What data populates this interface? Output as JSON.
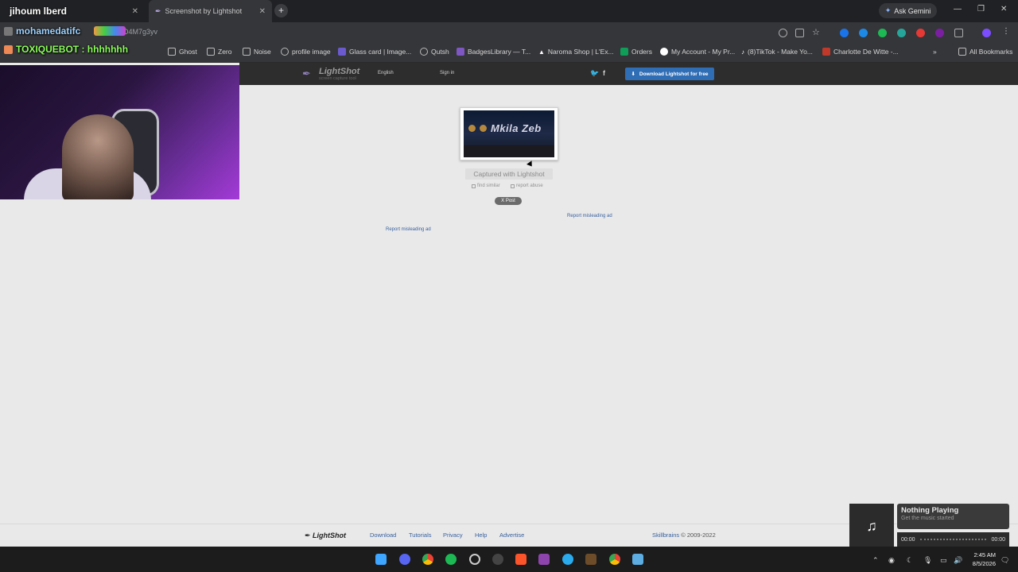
{
  "browser": {
    "tabs": [
      {
        "label": "jihoum lberd",
        "active": false
      },
      {
        "label": "Screenshot by Lightshot",
        "active": true
      }
    ],
    "new_tab": "+",
    "ask_gemini": "Ask Gemini",
    "url": "prnt.sc/3O4M7g3yv",
    "bookmarks": [
      {
        "label": "Ghost",
        "icon": "folder-icon"
      },
      {
        "label": "Zero",
        "icon": "folder-icon"
      },
      {
        "label": "Noise",
        "icon": "folder-icon"
      },
      {
        "label": "profile image",
        "icon": "globe-icon"
      },
      {
        "label": "Glass card | Image...",
        "icon": "purple-app-icon"
      },
      {
        "label": "Qutsh",
        "icon": "globe-icon"
      },
      {
        "label": "BadgesLibrary — T...",
        "icon": "badge-icon"
      },
      {
        "label": "Naroma Shop | L'Ex...",
        "icon": "triangle-icon"
      },
      {
        "label": "Orders",
        "icon": "sheet-icon"
      },
      {
        "label": "My Account - My Pr...",
        "icon": "account-icon"
      },
      {
        "label": "(8)TikTok - Make Yo...",
        "icon": "tiktok-icon"
      },
      {
        "label": "Charlotte De Witte -...",
        "icon": "image-icon"
      }
    ],
    "all_bookmarks": "All Bookmarks"
  },
  "stream_overlay": {
    "title_line": "jihoum lberd",
    "chat_user": "mohamedatifc",
    "bot_line": "TOXIQUEBOT : hhhhhhh"
  },
  "lightshot": {
    "logo": "LightShot",
    "tagline": "screen capture tool",
    "language": "English",
    "sign_in": "Sign in",
    "download_button": "Download Lightshot for free",
    "screenshot_text": "Mkila Zeb",
    "captured_with": "Captured with Lightshot",
    "find_similar": "find similar",
    "report_abuse": "report abuse",
    "x_post": "X Post",
    "report_ad_1": "Report misleading ad",
    "report_ad_2": "Report misleading ad",
    "footer": {
      "logo": "LightShot",
      "links": [
        "Download",
        "Tutorials",
        "Privacy",
        "Help",
        "Advertise"
      ],
      "copyright_link": "Skillbrains",
      "copyright": "© 2009-2022"
    }
  },
  "media": {
    "title": "Nothing Playing",
    "subtitle": "Get the music started",
    "time_start": "00:00",
    "time_end": "00:00"
  },
  "taskbar": {
    "time": "2:45 AM",
    "date": "8/5/2026"
  }
}
